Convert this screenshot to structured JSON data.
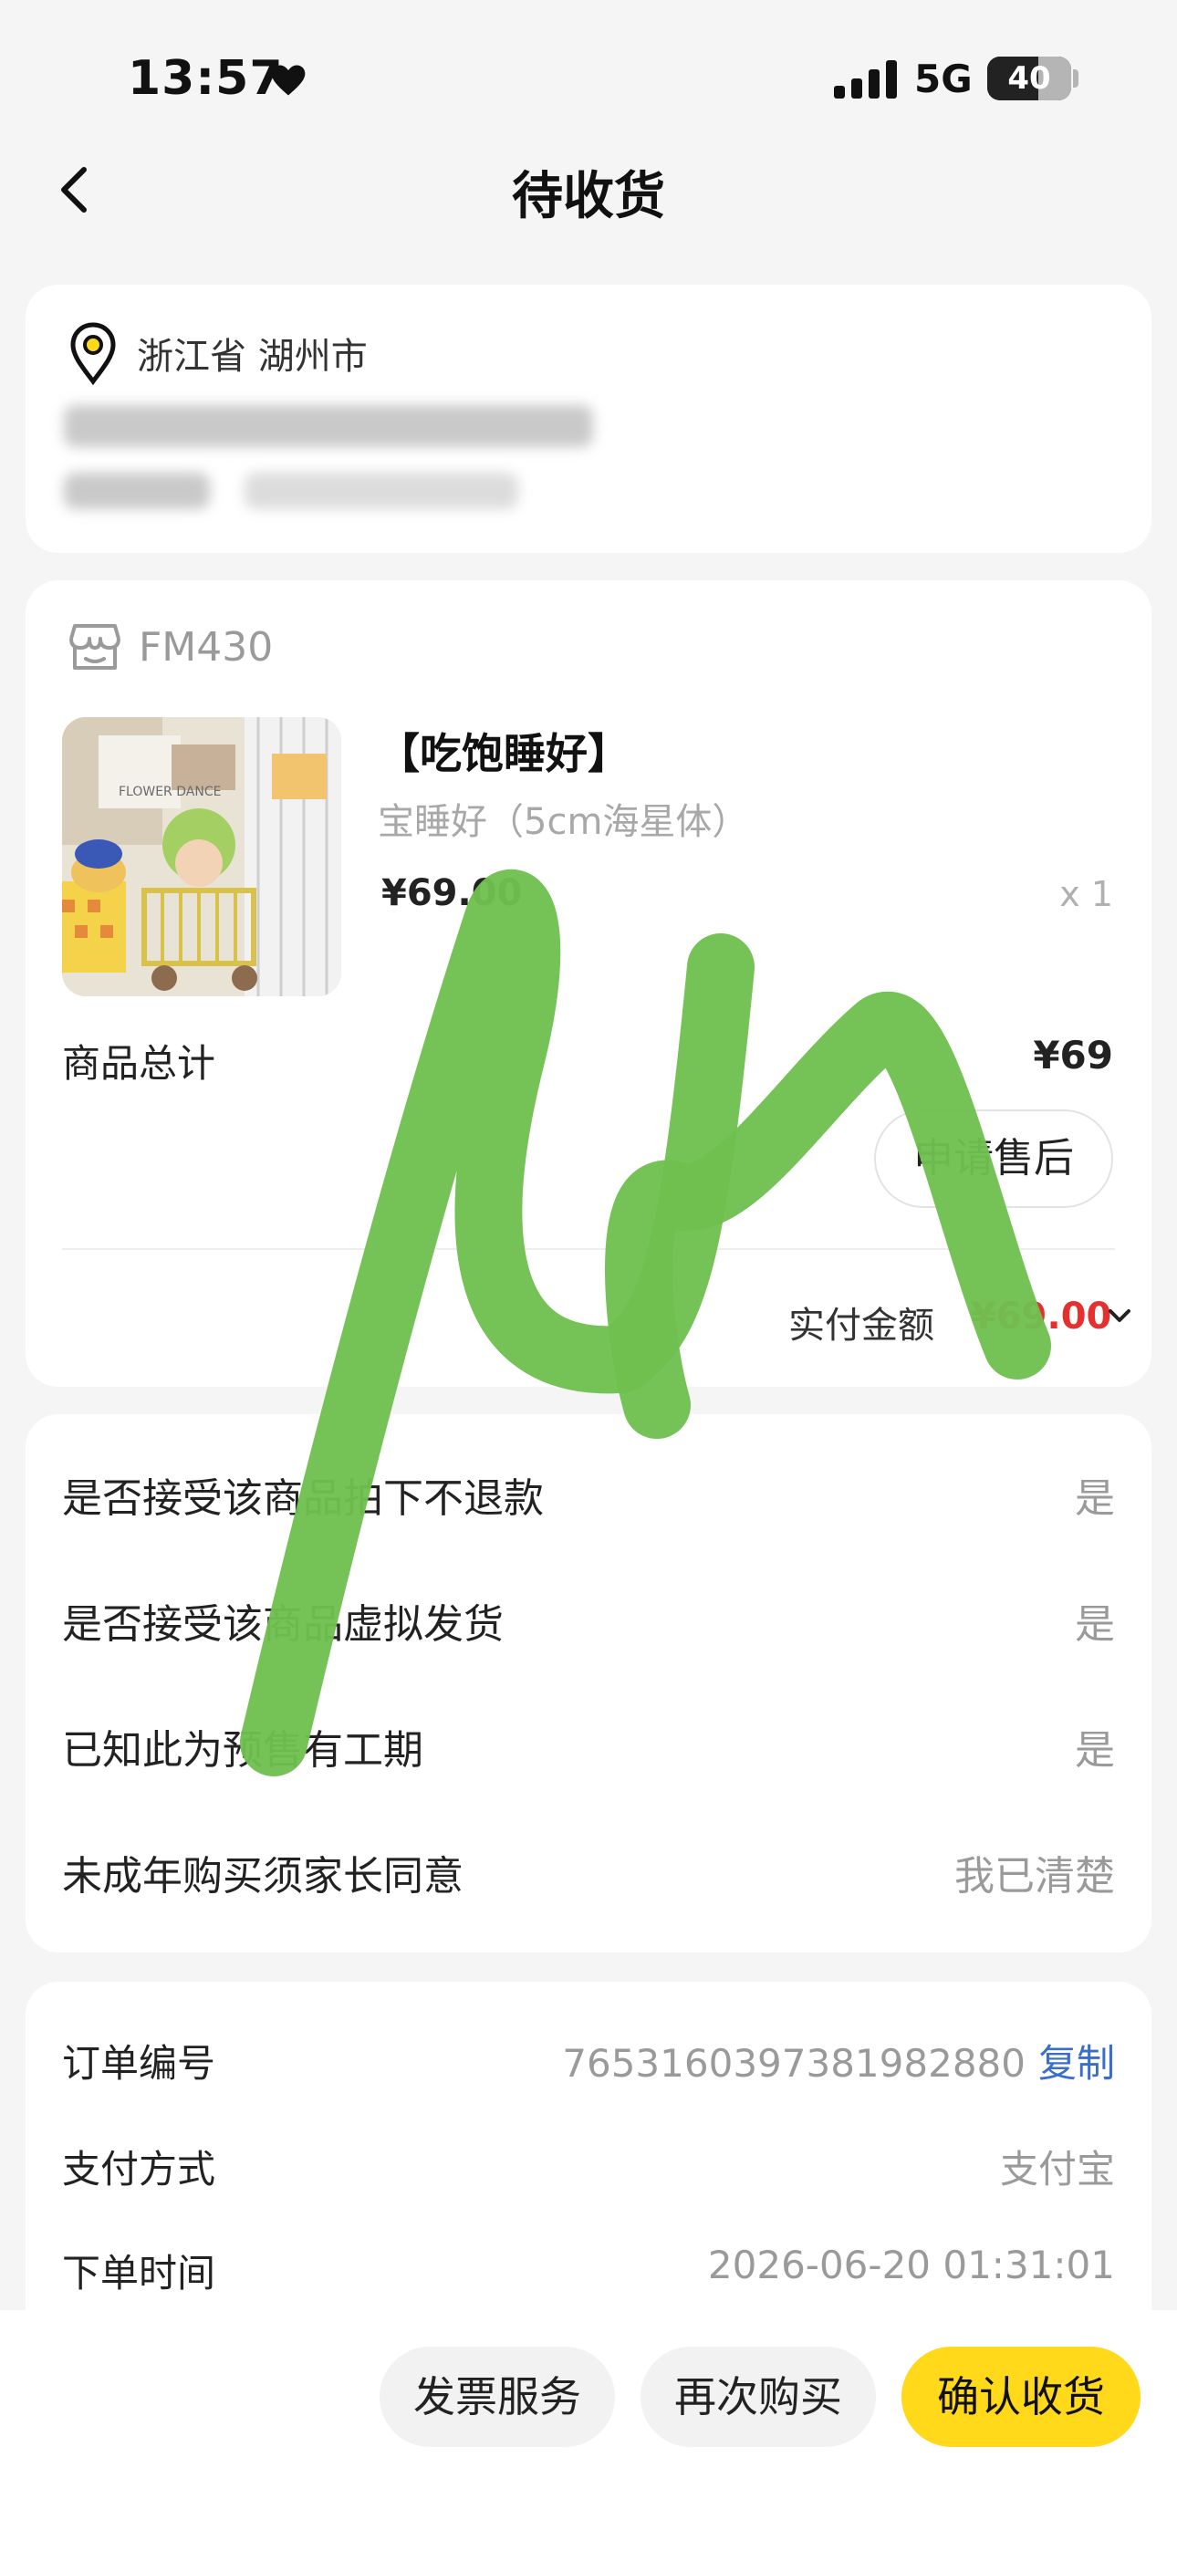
{
  "status_bar": {
    "time": "13:57",
    "network": "5G",
    "battery": "40"
  },
  "header": {
    "title": "待收货"
  },
  "address": {
    "region": "浙江省 湖州市"
  },
  "store": {
    "name": "FM430"
  },
  "product": {
    "title": "【吃饱睡好】",
    "variant": "宝睡好（5cm海星体）",
    "price": "¥69.00",
    "quantity": "x 1",
    "thumbnail_text": "FLOWER DANCE"
  },
  "summary": {
    "total_label": "商品总计",
    "total_value": "¥69",
    "after_sale_button": "申请售后",
    "paid_label": "实付金额",
    "paid_value": "¥69.00"
  },
  "options": [
    {
      "label": "是否接受该商品拍下不退款",
      "value": "是"
    },
    {
      "label": "是否接受该商品虚拟发货",
      "value": "是"
    },
    {
      "label": "已知此为预售有工期",
      "value": "是"
    },
    {
      "label": "未成年购买须家长同意",
      "value": "我已清楚"
    }
  ],
  "order_info": {
    "order_no_label": "订单编号",
    "order_no_value": "7653160397381982880",
    "copy_label": "复制",
    "pay_method_label": "支付方式",
    "pay_method_value": "支付宝",
    "order_time_label": "下单时间",
    "order_time_value": "2026-06-20 01:31:01"
  },
  "actions": {
    "invoice": "发票服务",
    "rebuy": "再次购买",
    "confirm": "确认收货"
  },
  "colors": {
    "accent_yellow": "#ffd91a",
    "price_red": "#e63030",
    "link_blue": "#3a6fc9",
    "scribble_green": "#6fbf4f"
  }
}
